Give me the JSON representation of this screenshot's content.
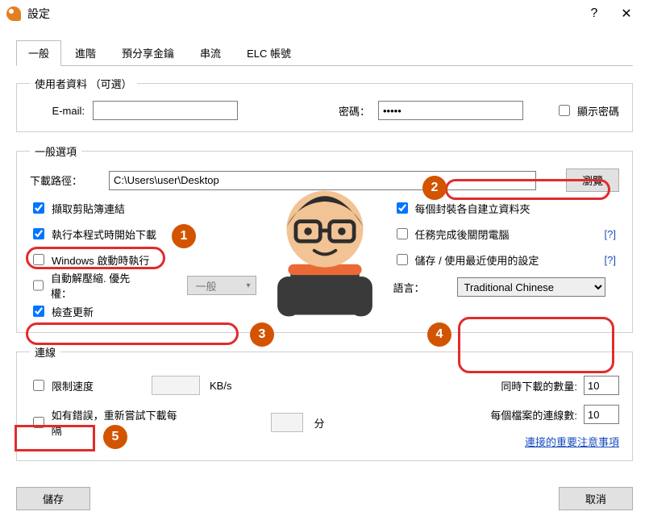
{
  "window": {
    "title": "設定",
    "help_glyph": "?",
    "close_glyph": "✕"
  },
  "tabs": {
    "items": [
      {
        "label": "一般"
      },
      {
        "label": "進階"
      },
      {
        "label": "預分享金鑰"
      },
      {
        "label": "串流"
      },
      {
        "label": "ELC 帳號"
      }
    ]
  },
  "user_info": {
    "legend": "使用者資料 （可選）",
    "email_label": "E-mail:",
    "email_value": "",
    "password_label": "密碼：",
    "password_value": "•••••",
    "show_password_label": "顯示密碼",
    "show_password_checked": false
  },
  "general_options": {
    "legend": "一般選項",
    "path_label": "下載路徑：",
    "path_value": "C:\\Users\\user\\Desktop",
    "browse_label": "瀏覽",
    "left_checks": [
      {
        "label": "擷取剪貼簿連結",
        "checked": true
      },
      {
        "label": "執行本程式時開始下載",
        "checked": true
      },
      {
        "label": "Windows 啟動時執行",
        "checked": false
      },
      {
        "label": "自動解壓縮. 優先權：",
        "checked": false
      },
      {
        "label": "檢查更新",
        "checked": true
      }
    ],
    "priority_options": [
      "一般"
    ],
    "priority_selected": "一般",
    "right_checks": [
      {
        "label": "每個封裝各自建立資料夾",
        "checked": true
      },
      {
        "label": "任務完成後關閉電腦",
        "checked": false
      },
      {
        "label": "儲存 / 使用最近使用的設定",
        "checked": false
      }
    ],
    "language_label": "語言：",
    "language_options": [
      "Traditional Chinese"
    ],
    "language_selected": "Traditional Chinese",
    "help_glyph": "[?]"
  },
  "connection": {
    "legend": "連線",
    "limit_speed_label": "限制速度",
    "limit_speed_checked": false,
    "limit_speed_unit": "KB/s",
    "retry_label": "如有錯誤，重新嘗試下載每隔",
    "retry_checked": false,
    "retry_unit": "分",
    "concurrent_downloads_label": "同時下載的數量:",
    "concurrent_downloads_value": "10",
    "connections_per_file_label": "每個檔案的連線數:",
    "connections_per_file_value": "10",
    "notes_link": "連接的重要注意事項"
  },
  "footer": {
    "save_label": "儲存",
    "cancel_label": "取消"
  },
  "annotations": {
    "circles": [
      "1",
      "2",
      "3",
      "4",
      "5"
    ]
  }
}
